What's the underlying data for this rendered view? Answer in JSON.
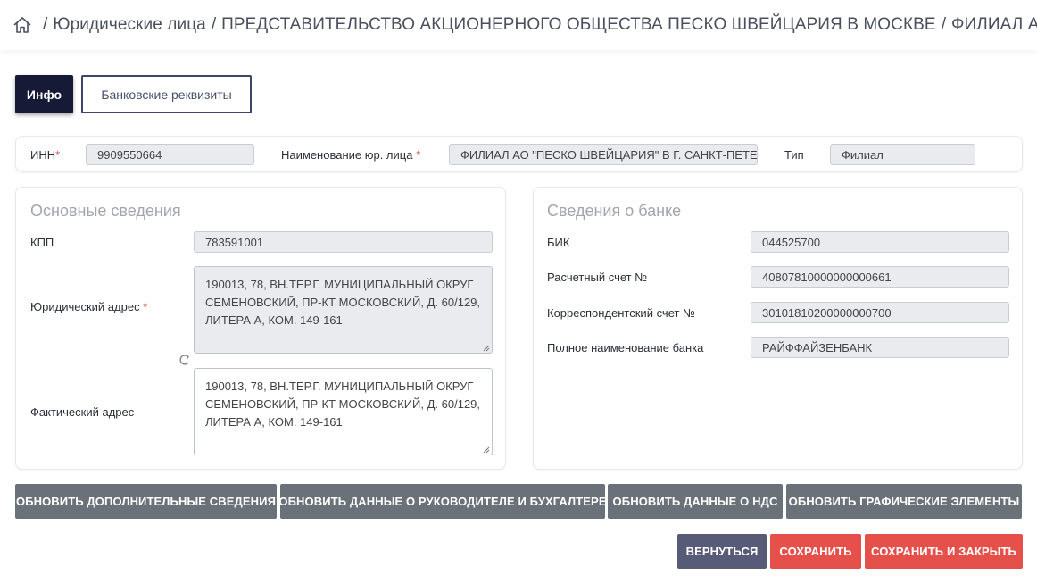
{
  "breadcrumb": {
    "items": [
      "Юридические лица",
      "ПРЕДСТАВИТЕЛЬСТВО АКЦИОНЕРНОГО ОБЩЕСТВА ПЕСКО ШВЕЙЦАРИЯ В МОСКВЕ",
      "ФИЛИАЛ АО \"ПЕСКО ШВЕЙЦАРИЯ\" В Г. САНКТ-ПЕТЕРБУРГ"
    ],
    "separator": "/"
  },
  "tabs": [
    {
      "label": "Инфо",
      "active": true
    },
    {
      "label": "Банковские реквизиты",
      "active": false
    }
  ],
  "header_card": {
    "inn_label": "ИНН",
    "inn_value": "9909550664",
    "name_label": "Наименование юр. лица",
    "name_value": "ФИЛИАЛ АО \"ПЕСКО ШВЕЙЦАРИЯ\" В Г. САНКТ-ПЕТЕРБУРГ",
    "type_label": "Тип",
    "type_value": "Филиал",
    "required_mark": "*"
  },
  "main_info": {
    "title": "Основные сведения",
    "kpp_label": "КПП",
    "kpp_value": "783591001",
    "legal_address_label": "Юридический адрес",
    "legal_address_value": "190013, 78, ВН.ТЕР.Г. МУНИЦИПАЛЬНЫЙ ОКРУГ СЕМЕНОВСКИЙ, ПР-КТ МОСКОВСКИЙ, Д. 60/129, ЛИТЕРА А, КОМ. 149-161",
    "actual_address_label": "Фактический адрес",
    "actual_address_value": "190013, 78, ВН.ТЕР.Г. МУНИЦИПАЛЬНЫЙ ОКРУГ СЕМЕНОВСКИЙ, ПР-КТ МОСКОВСКИЙ, Д. 60/129, ЛИТЕРА А, КОМ. 149-161"
  },
  "bank_info": {
    "title": "Сведения о банке",
    "bik_label": "БИК",
    "bik_value": "044525700",
    "account_label": "Расчетный счет №",
    "account_value": "40807810000000000661",
    "corr_label": "Корреспондентский счет №",
    "corr_value": "30101810200000000700",
    "bank_name_label": "Полное наименование банка",
    "bank_name_value": "РАЙФФАЙЗЕНБАНК"
  },
  "update_buttons": {
    "additional": "ОБНОВИТЬ ДОПОЛНИТЕЛЬНЫЕ СВЕДЕНИЯ",
    "director": "ОБНОВИТЬ ДАННЫЕ О РУКОВОДИТЕЛЕ И БУХГАЛТЕРЕ",
    "vat": "ОБНОВИТЬ ДАННЫЕ О НДС",
    "graphics": "ОБНОВИТЬ ГРАФИЧЕСКИЕ ЭЛЕМЕНТЫ"
  },
  "actions": {
    "back": "ВЕРНУТЬСЯ",
    "save": "СОХРАНИТЬ",
    "save_close": "СОХРАНИТЬ И ЗАКРЫТЬ"
  },
  "colors": {
    "tab_active": "#161a36",
    "button_grey": "#6b7178",
    "button_back": "#585b78",
    "button_save": "#e5514a",
    "required": "#e2473f"
  },
  "icons": {
    "home": "home-icon",
    "sync": "sync-icon",
    "resize": "resize-grip-icon"
  }
}
